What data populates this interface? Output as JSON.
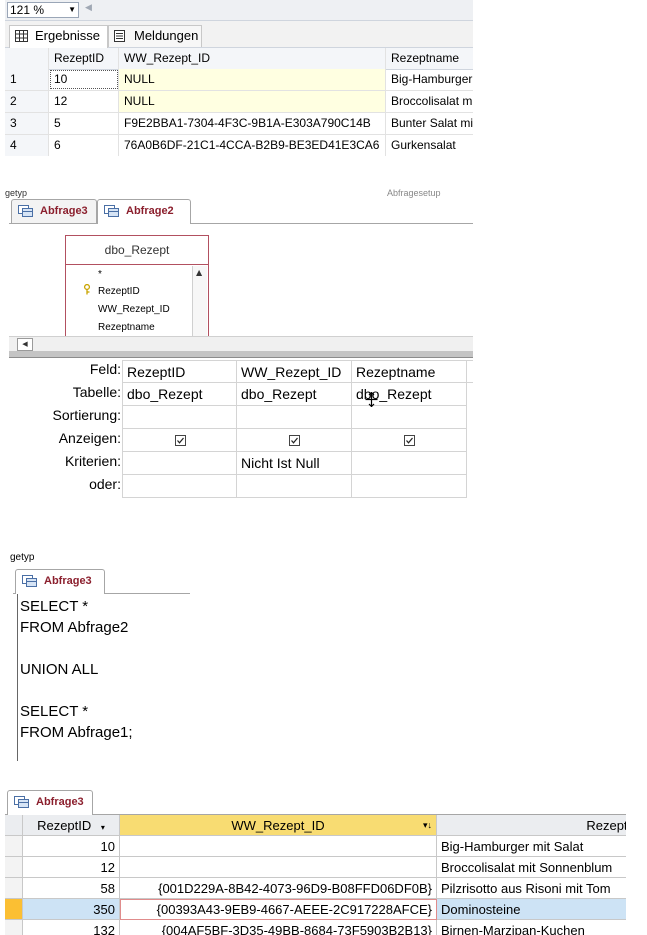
{
  "ssms": {
    "zoom": "121 %",
    "tabs": [
      {
        "label": "Ergebnisse",
        "icon": "grid-icon"
      },
      {
        "label": "Meldungen",
        "icon": "messages-icon"
      }
    ],
    "columns": [
      "RezeptID",
      "WW_Rezept_ID",
      "Rezeptname"
    ],
    "rows": [
      {
        "n": "1",
        "id": "10",
        "ww": "NULL",
        "name": "Big-Hamburger"
      },
      {
        "n": "2",
        "id": "12",
        "ww": "NULL",
        "name": "Broccolisalat m"
      },
      {
        "n": "3",
        "id": "5",
        "ww": "F9E2BBA1-7304-4F3C-9B1A-E303A790C14B",
        "name": "Bunter Salat mi"
      },
      {
        "n": "4",
        "id": "6",
        "ww": "76A0B6DF-21C1-4CCA-B2B9-BE3ED41E3CA6",
        "name": "Gurkensalat"
      }
    ]
  },
  "designer": {
    "caption": "getyp",
    "caption_right": "Abfragesetup",
    "tabs": [
      {
        "label": "Abfrage3",
        "active": false
      },
      {
        "label": "Abfrage2",
        "active": true
      }
    ],
    "table": {
      "title": "dbo_Rezept",
      "fields": [
        "*",
        "RezeptID",
        "WW_Rezept_ID",
        "Rezeptname"
      ]
    },
    "row_labels": [
      "Feld:",
      "Tabelle:",
      "Sortierung:",
      "Anzeigen:",
      "Kriterien:",
      "oder:"
    ],
    "columns": [
      {
        "field": "RezeptID",
        "table": "dbo_Rezept",
        "sort": "",
        "show": true,
        "criteria": ""
      },
      {
        "field": "WW_Rezept_ID",
        "table": "dbo_Rezept",
        "sort": "",
        "show": true,
        "criteria": "Nicht Ist Null"
      },
      {
        "field": "Rezeptname",
        "table": "dbo_Rezept",
        "sort": "",
        "show": true,
        "criteria": ""
      }
    ]
  },
  "sqlview": {
    "caption": "getyp",
    "tab": "Abfrage3",
    "lines": [
      "SELECT *",
      "FROM Abfrage2",
      "",
      "UNION ALL",
      "",
      "SELECT *",
      "FROM Abfrage1;"
    ]
  },
  "datasheet": {
    "tab": "Abfrage3",
    "columns": [
      "RezeptID",
      "WW_Rezept_ID",
      "Rezeptna"
    ],
    "rows": [
      {
        "id": "10",
        "ww": "",
        "name": "Big-Hamburger mit Salat",
        "current": false
      },
      {
        "id": "12",
        "ww": "",
        "name": "Broccolisalat mit Sonnenblum",
        "current": false
      },
      {
        "id": "58",
        "ww": "{001D229A-8B42-4073-96D9-B08FFD06DF0B}",
        "name": "Pilzrisotto aus Risoni mit Tom",
        "current": false
      },
      {
        "id": "350",
        "ww": "{00393A43-9EB9-4667-AEEE-2C917228AFCE}",
        "name": "Dominosteine",
        "current": true
      },
      {
        "id": "132",
        "ww": "{004AF5BF-3D35-49BB-8684-73F5903B2B13}",
        "name": "Birnen-Marzipan-Kuchen",
        "current": false
      }
    ]
  },
  "colors": {
    "access_accent": "#8b1f2d",
    "current_row": "#cde3f5",
    "record_selector_current": "#fbbf33",
    "null_cell": "#ffffe1"
  }
}
